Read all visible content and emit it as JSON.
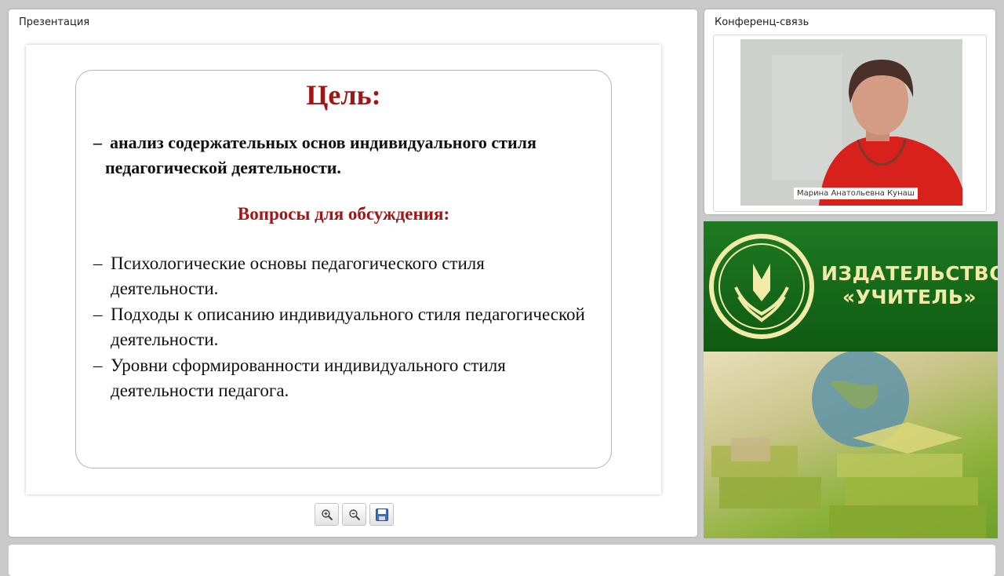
{
  "presentation": {
    "title": "Презентация",
    "slide": {
      "goal_title": "Цель:",
      "goal_text": "анализ содержательных основ индивидуального стиля педагогической деятельности.",
      "dash": "–",
      "questions_title": "Вопросы для обсуждения:",
      "questions": [
        "Психологические основы педагогического стиля деятельности.",
        "Подходы к описанию индивидуального стиля педагогической деятельности.",
        "Уровни сформированности индивидуального стиля деятельности педагога."
      ]
    },
    "toolbar": {
      "zoom_in_icon": "zoom-in-icon",
      "zoom_out_icon": "zoom-out-icon",
      "save_icon": "save-icon"
    }
  },
  "conference": {
    "title": "Конференц-связь",
    "participant_name": "Марина Анатольевна Кунаш"
  },
  "banner": {
    "publisher_line1": "ИЗДАТЕЛЬСТВО",
    "publisher_line2": "«УЧИТЕЛЬ»",
    "colors": {
      "green": "#1a6e1d",
      "text": "#f2eba7"
    }
  },
  "colors": {
    "accent_red": "#a31515",
    "background": "#c9c9c9"
  }
}
